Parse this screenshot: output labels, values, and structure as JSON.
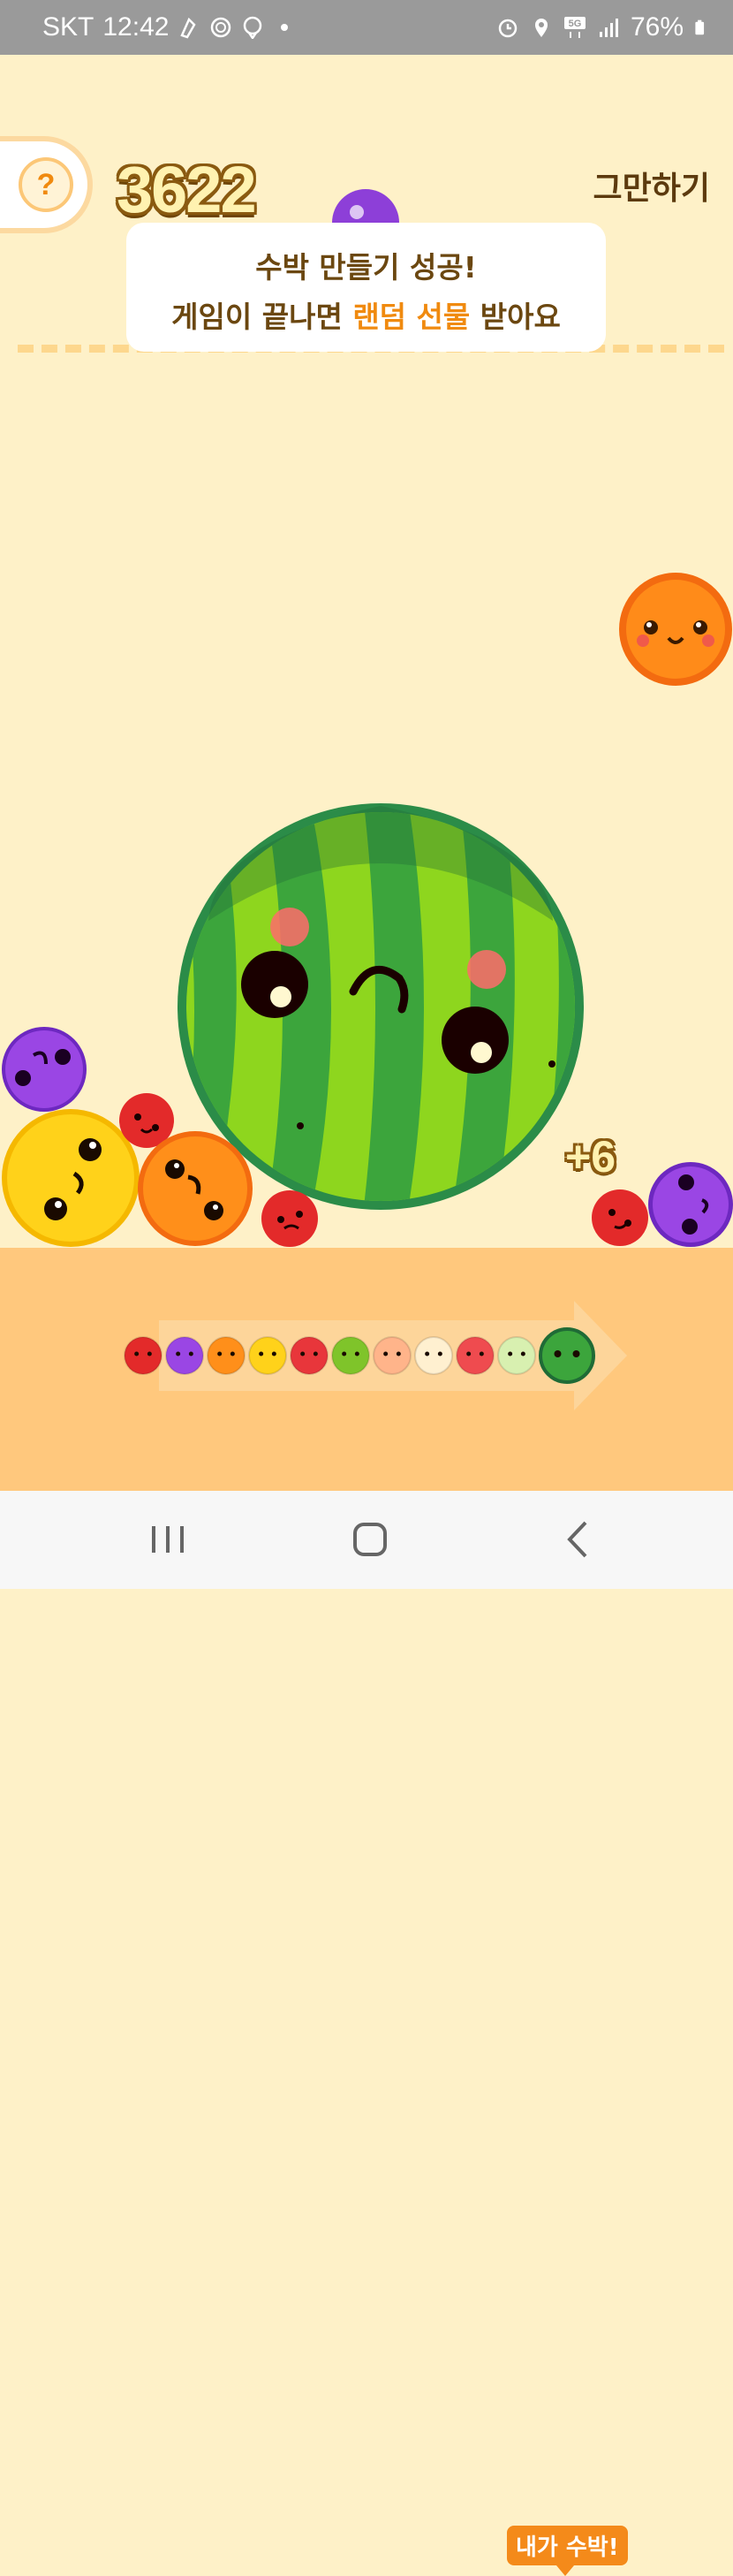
{
  "status_bar": {
    "carrier": "SKT",
    "time": "12:42",
    "battery": "76%",
    "icons": [
      "kakao-icon",
      "settings-icon",
      "location-pin-icon",
      "dot-icon",
      "alarm-icon",
      "location-icon",
      "5g-icon",
      "signal-icon",
      "battery-icon"
    ]
  },
  "game": {
    "score": "3622",
    "quit_label": "그만하기",
    "help_label": "?",
    "toast": {
      "line1": "수박 만들기 성공!",
      "line2_prefix": "게임이 끝나면 ",
      "line2_highlight": "랜덤 선물",
      "line2_suffix": " 받아요"
    },
    "bonus": "+6",
    "goal_badge": "내가 수박!",
    "fruit_chain": [
      "cherry",
      "grape",
      "tangerine",
      "lemon",
      "apple",
      "kiwi",
      "peach",
      "pear",
      "melon-red",
      "melon",
      "watermelon"
    ]
  },
  "colors": {
    "background": "#fef1c8",
    "ground": "#ffc87d",
    "accent": "#f08a0f",
    "text_dark": "#6b4710"
  }
}
